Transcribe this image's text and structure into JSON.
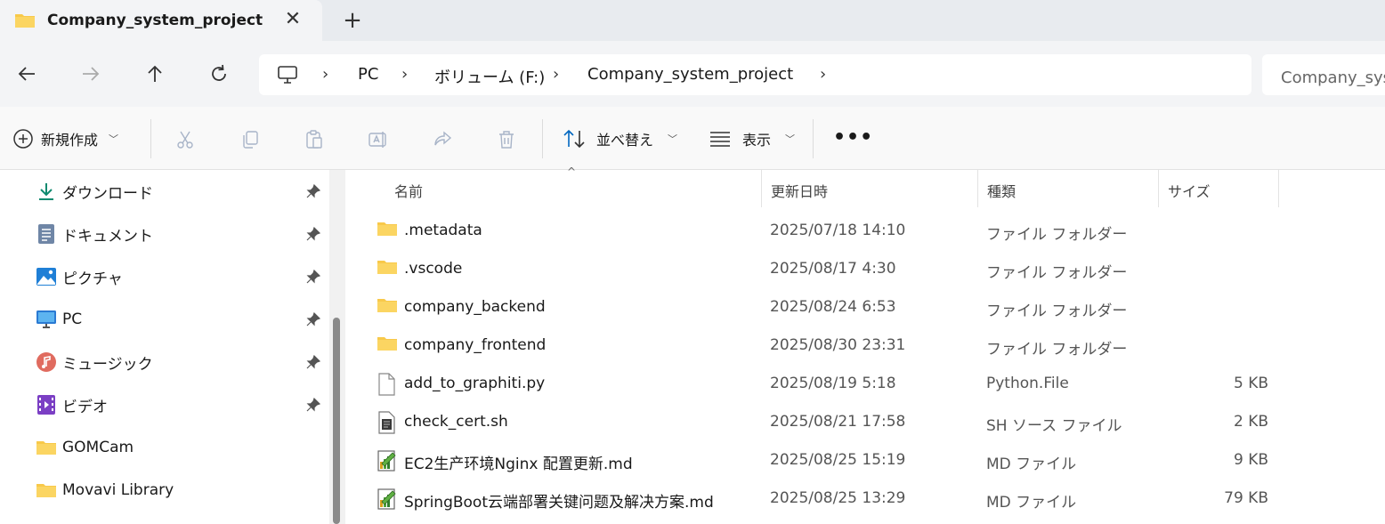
{
  "tab": {
    "title": "Company_system_project",
    "close": "✕",
    "new_tab": "+"
  },
  "address": {
    "crumbs": [
      "PC",
      "ボリューム (F:)",
      "Company_system_project"
    ],
    "search_placeholder": "Company_system_project の検索"
  },
  "toolbar": {
    "new_label": "新規作成",
    "sort_label": "並べ替え",
    "view_label": "表示",
    "more": "•••"
  },
  "sidebar": {
    "items": [
      {
        "label": "ダウンロード",
        "icon": "download-icon",
        "pinned": true
      },
      {
        "label": "ドキュメント",
        "icon": "documents-icon",
        "pinned": true
      },
      {
        "label": "ピクチャ",
        "icon": "pictures-icon",
        "pinned": true
      },
      {
        "label": "PC",
        "icon": "pc-icon",
        "pinned": true
      },
      {
        "label": "ミュージック",
        "icon": "music-icon",
        "pinned": true
      },
      {
        "label": "ビデオ",
        "icon": "video-icon",
        "pinned": true
      },
      {
        "label": "GOMCam",
        "icon": "folder-icon",
        "pinned": false
      },
      {
        "label": "Movavi Library",
        "icon": "folder-icon",
        "pinned": false
      }
    ]
  },
  "columns": {
    "name": "名前",
    "date": "更新日時",
    "type": "種類",
    "size": "サイズ"
  },
  "files": [
    {
      "name": ".metadata",
      "date": "2025/07/18 14:10",
      "type": "ファイル フォルダー",
      "size": "",
      "icon": "folder-icon"
    },
    {
      "name": ".vscode",
      "date": "2025/08/17 4:30",
      "type": "ファイル フォルダー",
      "size": "",
      "icon": "folder-icon"
    },
    {
      "name": "company_backend",
      "date": "2025/08/24 6:53",
      "type": "ファイル フォルダー",
      "size": "",
      "icon": "folder-icon"
    },
    {
      "name": "company_frontend",
      "date": "2025/08/30 23:31",
      "type": "ファイル フォルダー",
      "size": "",
      "icon": "folder-icon"
    },
    {
      "name": "add_to_graphiti.py",
      "date": "2025/08/19 5:18",
      "type": "Python.File",
      "size": "5 KB",
      "icon": "file-icon"
    },
    {
      "name": "check_cert.sh",
      "date": "2025/08/21 17:58",
      "type": "SH ソース ファイル",
      "size": "2 KB",
      "icon": "script-file-icon"
    },
    {
      "name": "EC2生产环境Nginx 配置更新.md",
      "date": "2025/08/25 15:19",
      "type": "MD ファイル",
      "size": "9 KB",
      "icon": "markdown-file-icon"
    },
    {
      "name": "SpringBoot云端部署关键问题及解决方案.md",
      "date": "2025/08/25 13:29",
      "type": "MD ファイル",
      "size": "79 KB",
      "icon": "markdown-file-icon"
    }
  ],
  "colors": {
    "folder": "#f8c94a",
    "accent": "#0067c0"
  }
}
